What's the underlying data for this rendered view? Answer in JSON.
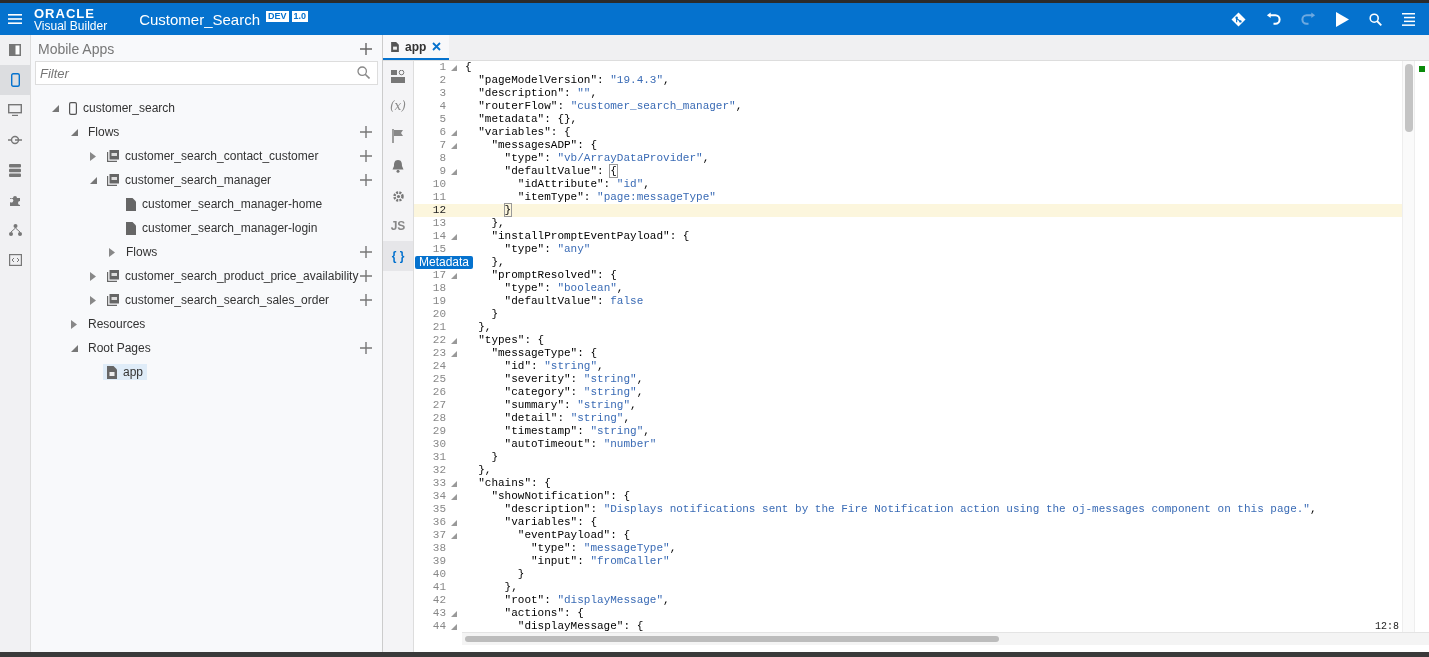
{
  "header": {
    "logo_top": "ORACLE",
    "logo_bottom": "Visual Builder",
    "title": "Customer_Search",
    "badges": [
      "DEV",
      "1.0"
    ],
    "actions": [
      {
        "kind": "git",
        "disabled": false
      },
      {
        "kind": "undo",
        "disabled": false
      },
      {
        "kind": "redo",
        "disabled": true
      },
      {
        "kind": "run",
        "disabled": false
      },
      {
        "kind": "search",
        "disabled": false
      },
      {
        "kind": "menu",
        "disabled": false
      }
    ]
  },
  "rail": [
    {
      "kind": "panel",
      "selected": false
    },
    {
      "kind": "mobile",
      "selected": true
    },
    {
      "kind": "web",
      "selected": false
    },
    {
      "kind": "service",
      "selected": false
    },
    {
      "kind": "data",
      "selected": false
    },
    {
      "kind": "component",
      "selected": false
    },
    {
      "kind": "process",
      "selected": false
    },
    {
      "kind": "source",
      "selected": false
    }
  ],
  "navigator": {
    "title": "Mobile Apps",
    "filter": {
      "placeholder": "Filter"
    },
    "tree": [
      {
        "label": "customer_search",
        "kind": "app",
        "expanded": true,
        "add": false,
        "selected": false,
        "children": [
          {
            "label": "Flows",
            "expanded": true,
            "add": true,
            "selected": false,
            "children": [
              {
                "label": "customer_search_contact_customer",
                "kind": "flow",
                "expanded": false,
                "add": true,
                "selected": false
              },
              {
                "label": "customer_search_manager",
                "kind": "flow",
                "expanded": true,
                "add": true,
                "selected": false,
                "children": [
                  {
                    "label": "customer_search_manager-home",
                    "kind": "page",
                    "add": false,
                    "selected": false
                  },
                  {
                    "label": "customer_search_manager-login",
                    "kind": "page",
                    "add": false,
                    "selected": false
                  },
                  {
                    "label": "Flows",
                    "expanded": false,
                    "add": true,
                    "selected": false
                  }
                ]
              },
              {
                "label": "customer_search_product_price_availability",
                "kind": "flow",
                "expanded": false,
                "add": true,
                "selected": false
              },
              {
                "label": "customer_search_search_sales_order",
                "kind": "flow",
                "expanded": false,
                "add": true,
                "selected": false
              }
            ]
          },
          {
            "label": "Resources",
            "expanded": false,
            "add": false,
            "selected": false
          },
          {
            "label": "Root Pages",
            "expanded": true,
            "add": true,
            "selected": false,
            "children": [
              {
                "label": "app",
                "kind": "root-page",
                "add": false,
                "selected": true
              }
            ]
          }
        ]
      }
    ]
  },
  "editor": {
    "tab": {
      "label": "app",
      "selected": true
    },
    "tools": [
      {
        "kind": "designer",
        "selected": false
      },
      {
        "kind": "variables",
        "label": "(x)",
        "selected": false
      },
      {
        "kind": "flag",
        "selected": false
      },
      {
        "kind": "events",
        "selected": false
      },
      {
        "kind": "settings",
        "selected": false
      },
      {
        "kind": "js",
        "label": "JS",
        "selected": false
      },
      {
        "kind": "json",
        "label": "{ }",
        "selected": true
      }
    ],
    "tooltip": "Metadata",
    "lines": [
      {
        "n": "1",
        "fold": true,
        "parts": [
          {
            "text": "{",
            "kind": "plain"
          }
        ]
      },
      {
        "n": "2",
        "fold": false,
        "parts": [
          {
            "text": "  \"pageModelVersion\": ",
            "kind": "plain"
          },
          {
            "text": "\"19.4.3\"",
            "kind": "string"
          },
          {
            "text": ",",
            "kind": "plain"
          }
        ]
      },
      {
        "n": "3",
        "fold": false,
        "parts": [
          {
            "text": "  \"description\": ",
            "kind": "plain"
          },
          {
            "text": "\"\"",
            "kind": "string"
          },
          {
            "text": ",",
            "kind": "plain"
          }
        ]
      },
      {
        "n": "4",
        "fold": false,
        "parts": [
          {
            "text": "  \"routerFlow\": ",
            "kind": "plain"
          },
          {
            "text": "\"customer_search_manager\"",
            "kind": "string"
          },
          {
            "text": ",",
            "kind": "plain"
          }
        ]
      },
      {
        "n": "5",
        "fold": false,
        "parts": [
          {
            "text": "  \"metadata\": {},",
            "kind": "plain"
          }
        ]
      },
      {
        "n": "6",
        "fold": true,
        "parts": [
          {
            "text": "  \"variables\": {",
            "kind": "plain"
          }
        ]
      },
      {
        "n": "7",
        "fold": true,
        "parts": [
          {
            "text": "    \"messagesADP\": {",
            "kind": "plain"
          }
        ]
      },
      {
        "n": "8",
        "fold": false,
        "parts": [
          {
            "text": "      \"type\": ",
            "kind": "plain"
          },
          {
            "text": "\"vb/ArrayDataProvider\"",
            "kind": "string"
          },
          {
            "text": ",",
            "kind": "plain"
          }
        ]
      },
      {
        "n": "9",
        "fold": true,
        "parts": [
          {
            "text": "      \"defaultValue\": ",
            "kind": "plain"
          },
          {
            "text": "{",
            "kind": "bracket"
          }
        ]
      },
      {
        "n": "10",
        "fold": false,
        "parts": [
          {
            "text": "        \"idAttribute\": ",
            "kind": "plain"
          },
          {
            "text": "\"id\"",
            "kind": "string"
          },
          {
            "text": ",",
            "kind": "plain"
          }
        ]
      },
      {
        "n": "11",
        "fold": false,
        "parts": [
          {
            "text": "        \"itemType\": ",
            "kind": "plain"
          },
          {
            "text": "\"page:messageType\"",
            "kind": "string"
          }
        ]
      },
      {
        "n": "12",
        "fold": false,
        "current": true,
        "parts": [
          {
            "text": "      }",
            "kind": "bracket"
          }
        ]
      },
      {
        "n": "13",
        "fold": false,
        "parts": [
          {
            "text": "    },",
            "kind": "plain"
          }
        ]
      },
      {
        "n": "14",
        "fold": true,
        "parts": [
          {
            "text": "    \"installPromptEventPayload\": {",
            "kind": "plain"
          }
        ]
      },
      {
        "n": "15",
        "fold": false,
        "parts": [
          {
            "text": "      \"type\": ",
            "kind": "plain"
          },
          {
            "text": "\"any\"",
            "kind": "string"
          }
        ]
      },
      {
        "fold": false,
        "parts": [
          {
            "text": "    },",
            "kind": "plain"
          }
        ]
      },
      {
        "n": "17",
        "fold": true,
        "parts": [
          {
            "text": "    \"promptResolved\": {",
            "kind": "plain"
          }
        ]
      },
      {
        "n": "18",
        "fold": false,
        "parts": [
          {
            "text": "      \"type\": ",
            "kind": "plain"
          },
          {
            "text": "\"boolean\"",
            "kind": "string"
          },
          {
            "text": ",",
            "kind": "plain"
          }
        ]
      },
      {
        "n": "19",
        "fold": false,
        "parts": [
          {
            "text": "      \"defaultValue\": ",
            "kind": "plain"
          },
          {
            "text": "false",
            "kind": "string"
          }
        ]
      },
      {
        "n": "20",
        "fold": false,
        "parts": [
          {
            "text": "    }",
            "kind": "plain"
          }
        ]
      },
      {
        "n": "21",
        "fold": false,
        "parts": [
          {
            "text": "  },",
            "kind": "plain"
          }
        ]
      },
      {
        "n": "22",
        "fold": true,
        "parts": [
          {
            "text": "  \"types\": {",
            "kind": "plain"
          }
        ]
      },
      {
        "n": "23",
        "fold": true,
        "parts": [
          {
            "text": "    \"messageType\": {",
            "kind": "plain"
          }
        ]
      },
      {
        "n": "24",
        "fold": false,
        "parts": [
          {
            "text": "      \"id\": ",
            "kind": "plain"
          },
          {
            "text": "\"string\"",
            "kind": "string"
          },
          {
            "text": ",",
            "kind": "plain"
          }
        ]
      },
      {
        "n": "25",
        "fold": false,
        "parts": [
          {
            "text": "      \"severity\": ",
            "kind": "plain"
          },
          {
            "text": "\"string\"",
            "kind": "string"
          },
          {
            "text": ",",
            "kind": "plain"
          }
        ]
      },
      {
        "n": "26",
        "fold": false,
        "parts": [
          {
            "text": "      \"category\": ",
            "kind": "plain"
          },
          {
            "text": "\"string\"",
            "kind": "string"
          },
          {
            "text": ",",
            "kind": "plain"
          }
        ]
      },
      {
        "n": "27",
        "fold": false,
        "parts": [
          {
            "text": "      \"summary\": ",
            "kind": "plain"
          },
          {
            "text": "\"string\"",
            "kind": "string"
          },
          {
            "text": ",",
            "kind": "plain"
          }
        ]
      },
      {
        "n": "28",
        "fold": false,
        "parts": [
          {
            "text": "      \"detail\": ",
            "kind": "plain"
          },
          {
            "text": "\"string\"",
            "kind": "string"
          },
          {
            "text": ",",
            "kind": "plain"
          }
        ]
      },
      {
        "n": "29",
        "fold": false,
        "parts": [
          {
            "text": "      \"timestamp\": ",
            "kind": "plain"
          },
          {
            "text": "\"string\"",
            "kind": "string"
          },
          {
            "text": ",",
            "kind": "plain"
          }
        ]
      },
      {
        "n": "30",
        "fold": false,
        "parts": [
          {
            "text": "      \"autoTimeout\": ",
            "kind": "plain"
          },
          {
            "text": "\"number\"",
            "kind": "string"
          }
        ]
      },
      {
        "n": "31",
        "fold": false,
        "parts": [
          {
            "text": "    }",
            "kind": "plain"
          }
        ]
      },
      {
        "n": "32",
        "fold": false,
        "parts": [
          {
            "text": "  },",
            "kind": "plain"
          }
        ]
      },
      {
        "n": "33",
        "fold": true,
        "parts": [
          {
            "text": "  \"chains\": {",
            "kind": "plain"
          }
        ]
      },
      {
        "n": "34",
        "fold": true,
        "parts": [
          {
            "text": "    \"showNotification\": {",
            "kind": "plain"
          }
        ]
      },
      {
        "n": "35",
        "fold": false,
        "parts": [
          {
            "text": "      \"description\": ",
            "kind": "plain"
          },
          {
            "text": "\"Displays notifications sent by the Fire Notification action using the oj-messages component on this page.\"",
            "kind": "string"
          },
          {
            "text": ",",
            "kind": "plain"
          }
        ]
      },
      {
        "n": "36",
        "fold": true,
        "parts": [
          {
            "text": "      \"variables\": {",
            "kind": "plain"
          }
        ]
      },
      {
        "n": "37",
        "fold": true,
        "parts": [
          {
            "text": "        \"eventPayload\": {",
            "kind": "plain"
          }
        ]
      },
      {
        "n": "38",
        "fold": false,
        "parts": [
          {
            "text": "          \"type\": ",
            "kind": "plain"
          },
          {
            "text": "\"messageType\"",
            "kind": "string"
          },
          {
            "text": ",",
            "kind": "plain"
          }
        ]
      },
      {
        "n": "39",
        "fold": false,
        "parts": [
          {
            "text": "          \"input\": ",
            "kind": "plain"
          },
          {
            "text": "\"fromCaller\"",
            "kind": "string"
          }
        ]
      },
      {
        "n": "40",
        "fold": false,
        "parts": [
          {
            "text": "        }",
            "kind": "plain"
          }
        ]
      },
      {
        "n": "41",
        "fold": false,
        "parts": [
          {
            "text": "      },",
            "kind": "plain"
          }
        ]
      },
      {
        "n": "42",
        "fold": false,
        "parts": [
          {
            "text": "      \"root\": ",
            "kind": "plain"
          },
          {
            "text": "\"displayMessage\"",
            "kind": "string"
          },
          {
            "text": ",",
            "kind": "plain"
          }
        ]
      },
      {
        "n": "43",
        "fold": true,
        "parts": [
          {
            "text": "      \"actions\": {",
            "kind": "plain"
          }
        ]
      },
      {
        "n": "44",
        "fold": true,
        "parts": [
          {
            "text": "        \"displayMessage\": {",
            "kind": "plain"
          }
        ]
      }
    ],
    "cursor": "12:8"
  }
}
